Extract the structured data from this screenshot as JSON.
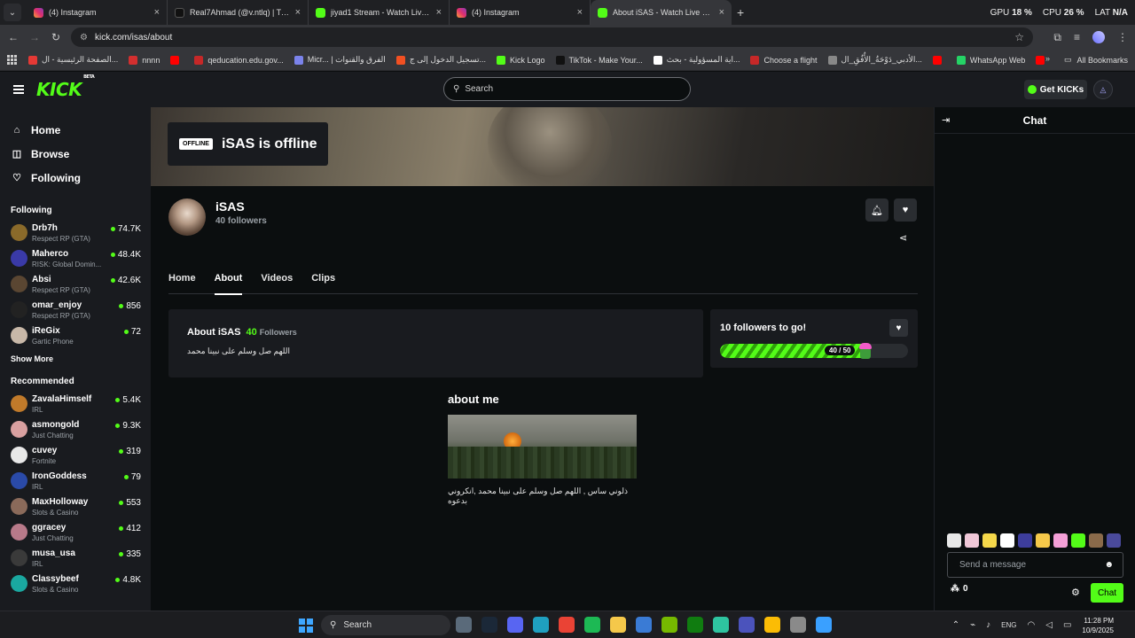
{
  "browser": {
    "tabs": [
      {
        "title": "(4) Instagram",
        "icon": "instagram-icon",
        "active": false
      },
      {
        "title": "Real7Ahmad (@v.ntlq) | TikTok",
        "icon": "tiktok-icon",
        "active": false
      },
      {
        "title": "jiyad1 Stream - Watch Live on Kick",
        "icon": "kick-icon",
        "active": false
      },
      {
        "title": "(4) Instagram",
        "icon": "instagram-icon",
        "active": false
      },
      {
        "title": "About iSAS - Watch Live on Kick",
        "icon": "kick-icon",
        "active": true
      }
    ],
    "url": "kick.com/isas/about",
    "system_monitor": {
      "gpu_label": "GPU",
      "gpu_value": "18 %",
      "cpu_label": "CPU",
      "cpu_value": "26 %",
      "lat_label": "LAT",
      "lat_value": "N/A"
    },
    "bookmarks": [
      {
        "label": "الصفحة الرئيسية - ال...",
        "color": "#e53935"
      },
      {
        "label": "nnnn",
        "color": "#d32f2f"
      },
      {
        "label": "",
        "color": "#ff0000"
      },
      {
        "label": "qeducation.edu.gov...",
        "color": "#c62828"
      },
      {
        "label": "Micr... | الفرق والقنوات",
        "color": "#7b83eb"
      },
      {
        "label": "تسجيل الدخول إلى ج...",
        "color": "#f25022"
      },
      {
        "label": "Kick Logo",
        "color": "#53fc18"
      },
      {
        "label": "TikTok - Make Your...",
        "color": "#111111"
      },
      {
        "label": "اية المسؤولية - بحث...",
        "color": "#ffffff"
      },
      {
        "label": "Choose a flight",
        "color": "#c62828"
      },
      {
        "label": "الأدبي_دَوْحَةُ_الأُفُقِ_ال...",
        "color": "#888888"
      },
      {
        "label": "",
        "color": "#ff0000"
      },
      {
        "label": "WhatsApp Web",
        "color": "#25d366"
      },
      {
        "label": "",
        "color": "#ff0000"
      }
    ],
    "all_bookmarks": "All Bookmarks"
  },
  "header": {
    "logo": "KICK",
    "logo_beta": "BETA",
    "search_placeholder": "Search",
    "get_kicks": "Get KICKs"
  },
  "sidebar": {
    "nav": [
      {
        "label": "Home",
        "icon": "home-icon",
        "glyph": "⌂"
      },
      {
        "label": "Browse",
        "icon": "browse-icon",
        "glyph": "◫"
      },
      {
        "label": "Following",
        "icon": "heart-icon",
        "glyph": "♡"
      }
    ],
    "following_title": "Following",
    "following": [
      {
        "name": "Drb7h",
        "category": "Respect RP (GTA)",
        "viewers": "74.7K",
        "color": "#8a6a2a"
      },
      {
        "name": "Maherco",
        "category": "RISK: Global Domin...",
        "viewers": "48.4K",
        "color": "#3a3aa8"
      },
      {
        "name": "Absi",
        "category": "Respect RP (GTA)",
        "viewers": "42.6K",
        "color": "#5a4632"
      },
      {
        "name": "omar_enjoy",
        "category": "Respect RP (GTA)",
        "viewers": "856",
        "color": "#222222"
      },
      {
        "name": "iReGix",
        "category": "Gartic Phone",
        "viewers": "72",
        "color": "#c8b8a8"
      }
    ],
    "show_more": "Show More",
    "recommended_title": "Recommended",
    "recommended": [
      {
        "name": "ZavalaHimself",
        "category": "IRL",
        "viewers": "5.4K",
        "color": "#c07a2a"
      },
      {
        "name": "asmongold",
        "category": "Just Chatting",
        "viewers": "9.3K",
        "color": "#d9a0a0"
      },
      {
        "name": "cuvey",
        "category": "Fortnite",
        "viewers": "319",
        "color": "#e8e8e8"
      },
      {
        "name": "IronGoddess",
        "category": "IRL",
        "viewers": "79",
        "color": "#2a4aa8"
      },
      {
        "name": "MaxHolloway",
        "category": "Slots & Casino",
        "viewers": "553",
        "color": "#8a6a5a"
      },
      {
        "name": "ggracey",
        "category": "Just Chatting",
        "viewers": "412",
        "color": "#b87a8a"
      },
      {
        "name": "musa_usa",
        "category": "IRL",
        "viewers": "335",
        "color": "#3a3a3a"
      },
      {
        "name": "Classybeef",
        "category": "Slots & Casino",
        "viewers": "4.8K",
        "color": "#1aa8a0"
      }
    ]
  },
  "channel": {
    "offline_badge": "OFFLINE",
    "offline_title": "iSAS is offline",
    "name": "iSAS",
    "followers": "40 followers",
    "tabs": [
      "Home",
      "About",
      "Videos",
      "Clips"
    ],
    "active_tab": "About",
    "about_title": "About iSAS",
    "about_followers_count": "40",
    "about_followers_label": "Followers",
    "about_bio": "اللهم صل وسلم على نبينا محمد",
    "goal_title": "10 followers to go!",
    "goal_label": "40 / 50",
    "goal_fraction": 0.8,
    "about_me_title": "about me",
    "about_me_text": "ذلوني ساس , اللهم صل وسلم على نبينا محمد ,انكروني بدعوه"
  },
  "chat": {
    "title": "Chat",
    "placeholder": "Send a message",
    "points": "0",
    "send_label": "Chat",
    "emote_colors": [
      "#e8e8e8",
      "#f0c8d8",
      "#f5d84a",
      "#ffffff",
      "#3d3d9c",
      "#f5c84a",
      "#f5a0d8",
      "#53fc18",
      "#8a6a4a",
      "#4a4a9c"
    ]
  },
  "taskbar": {
    "search": "Search",
    "icons": [
      {
        "name": "camera-app-icon",
        "color": "#5a6a7a"
      },
      {
        "name": "steam-icon",
        "color": "#1b2838"
      },
      {
        "name": "discord-icon",
        "color": "#5865f2"
      },
      {
        "name": "edge-icon",
        "color": "#1fa0c0"
      },
      {
        "name": "chrome-icon",
        "color": "#ea4335"
      },
      {
        "name": "spotify-icon",
        "color": "#1db954"
      },
      {
        "name": "explorer-icon",
        "color": "#f5c84a"
      },
      {
        "name": "store-icon",
        "color": "#3a7bd5"
      },
      {
        "name": "nvidia-icon",
        "color": "#76b900"
      },
      {
        "name": "xbox-icon",
        "color": "#107c10"
      },
      {
        "name": "app-icon",
        "color": "#2ec4a0"
      },
      {
        "name": "teams-icon",
        "color": "#4b53bc"
      },
      {
        "name": "chrome-active-icon",
        "color": "#fbbc05"
      },
      {
        "name": "settings-icon",
        "color": "#8a8a8a"
      },
      {
        "name": "copilot-icon",
        "color": "#3aa0ff"
      }
    ],
    "lang": "ENG",
    "time": "11:28 PM",
    "date": "10/9/2025"
  },
  "colors": {
    "kick_green": "#53fc18",
    "surface": "#191b1f",
    "background": "#0b0e0f"
  }
}
